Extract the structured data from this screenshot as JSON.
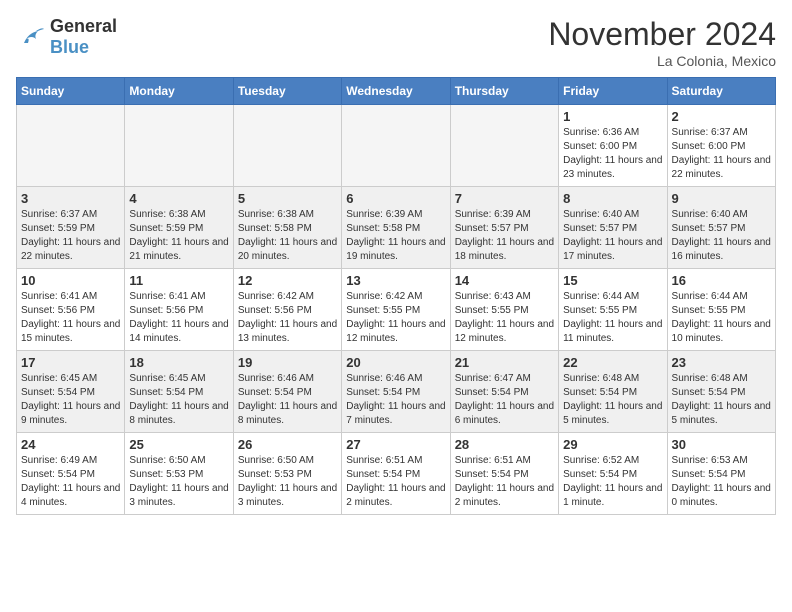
{
  "header": {
    "logo_general": "General",
    "logo_blue": "Blue",
    "month_title": "November 2024",
    "location": "La Colonia, Mexico"
  },
  "days_of_week": [
    "Sunday",
    "Monday",
    "Tuesday",
    "Wednesday",
    "Thursday",
    "Friday",
    "Saturday"
  ],
  "weeks": [
    [
      {
        "day": "",
        "info": "",
        "empty": true
      },
      {
        "day": "",
        "info": "",
        "empty": true
      },
      {
        "day": "",
        "info": "",
        "empty": true
      },
      {
        "day": "",
        "info": "",
        "empty": true
      },
      {
        "day": "",
        "info": "",
        "empty": true
      },
      {
        "day": "1",
        "info": "Sunrise: 6:36 AM\nSunset: 6:00 PM\nDaylight: 11 hours and 23 minutes."
      },
      {
        "day": "2",
        "info": "Sunrise: 6:37 AM\nSunset: 6:00 PM\nDaylight: 11 hours and 22 minutes."
      }
    ],
    [
      {
        "day": "3",
        "info": "Sunrise: 6:37 AM\nSunset: 5:59 PM\nDaylight: 11 hours and 22 minutes."
      },
      {
        "day": "4",
        "info": "Sunrise: 6:38 AM\nSunset: 5:59 PM\nDaylight: 11 hours and 21 minutes."
      },
      {
        "day": "5",
        "info": "Sunrise: 6:38 AM\nSunset: 5:58 PM\nDaylight: 11 hours and 20 minutes."
      },
      {
        "day": "6",
        "info": "Sunrise: 6:39 AM\nSunset: 5:58 PM\nDaylight: 11 hours and 19 minutes."
      },
      {
        "day": "7",
        "info": "Sunrise: 6:39 AM\nSunset: 5:57 PM\nDaylight: 11 hours and 18 minutes."
      },
      {
        "day": "8",
        "info": "Sunrise: 6:40 AM\nSunset: 5:57 PM\nDaylight: 11 hours and 17 minutes."
      },
      {
        "day": "9",
        "info": "Sunrise: 6:40 AM\nSunset: 5:57 PM\nDaylight: 11 hours and 16 minutes."
      }
    ],
    [
      {
        "day": "10",
        "info": "Sunrise: 6:41 AM\nSunset: 5:56 PM\nDaylight: 11 hours and 15 minutes."
      },
      {
        "day": "11",
        "info": "Sunrise: 6:41 AM\nSunset: 5:56 PM\nDaylight: 11 hours and 14 minutes."
      },
      {
        "day": "12",
        "info": "Sunrise: 6:42 AM\nSunset: 5:56 PM\nDaylight: 11 hours and 13 minutes."
      },
      {
        "day": "13",
        "info": "Sunrise: 6:42 AM\nSunset: 5:55 PM\nDaylight: 11 hours and 12 minutes."
      },
      {
        "day": "14",
        "info": "Sunrise: 6:43 AM\nSunset: 5:55 PM\nDaylight: 11 hours and 12 minutes."
      },
      {
        "day": "15",
        "info": "Sunrise: 6:44 AM\nSunset: 5:55 PM\nDaylight: 11 hours and 11 minutes."
      },
      {
        "day": "16",
        "info": "Sunrise: 6:44 AM\nSunset: 5:55 PM\nDaylight: 11 hours and 10 minutes."
      }
    ],
    [
      {
        "day": "17",
        "info": "Sunrise: 6:45 AM\nSunset: 5:54 PM\nDaylight: 11 hours and 9 minutes."
      },
      {
        "day": "18",
        "info": "Sunrise: 6:45 AM\nSunset: 5:54 PM\nDaylight: 11 hours and 8 minutes."
      },
      {
        "day": "19",
        "info": "Sunrise: 6:46 AM\nSunset: 5:54 PM\nDaylight: 11 hours and 8 minutes."
      },
      {
        "day": "20",
        "info": "Sunrise: 6:46 AM\nSunset: 5:54 PM\nDaylight: 11 hours and 7 minutes."
      },
      {
        "day": "21",
        "info": "Sunrise: 6:47 AM\nSunset: 5:54 PM\nDaylight: 11 hours and 6 minutes."
      },
      {
        "day": "22",
        "info": "Sunrise: 6:48 AM\nSunset: 5:54 PM\nDaylight: 11 hours and 5 minutes."
      },
      {
        "day": "23",
        "info": "Sunrise: 6:48 AM\nSunset: 5:54 PM\nDaylight: 11 hours and 5 minutes."
      }
    ],
    [
      {
        "day": "24",
        "info": "Sunrise: 6:49 AM\nSunset: 5:54 PM\nDaylight: 11 hours and 4 minutes."
      },
      {
        "day": "25",
        "info": "Sunrise: 6:50 AM\nSunset: 5:53 PM\nDaylight: 11 hours and 3 minutes."
      },
      {
        "day": "26",
        "info": "Sunrise: 6:50 AM\nSunset: 5:53 PM\nDaylight: 11 hours and 3 minutes."
      },
      {
        "day": "27",
        "info": "Sunrise: 6:51 AM\nSunset: 5:54 PM\nDaylight: 11 hours and 2 minutes."
      },
      {
        "day": "28",
        "info": "Sunrise: 6:51 AM\nSunset: 5:54 PM\nDaylight: 11 hours and 2 minutes."
      },
      {
        "day": "29",
        "info": "Sunrise: 6:52 AM\nSunset: 5:54 PM\nDaylight: 11 hours and 1 minute."
      },
      {
        "day": "30",
        "info": "Sunrise: 6:53 AM\nSunset: 5:54 PM\nDaylight: 11 hours and 0 minutes."
      }
    ]
  ]
}
